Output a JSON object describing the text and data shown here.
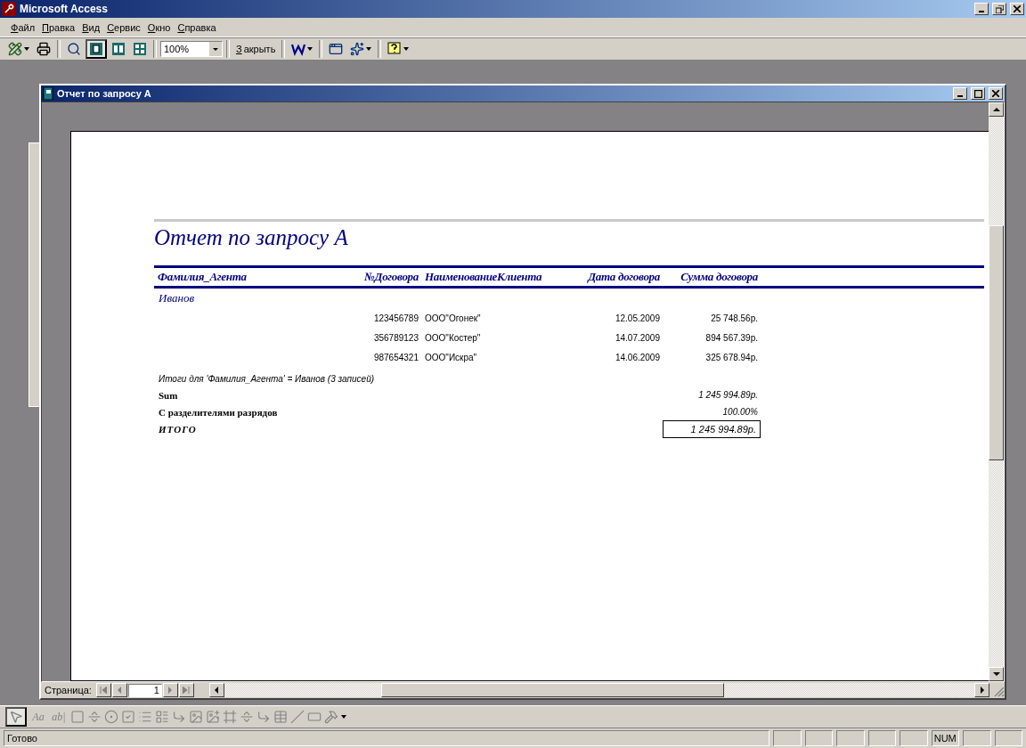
{
  "app_title": "Microsoft Access",
  "menu": [
    {
      "label": "Файл"
    },
    {
      "label": "Правка"
    },
    {
      "label": "Вид"
    },
    {
      "label": "Сервис"
    },
    {
      "label": "Окно"
    },
    {
      "label": "Справка"
    }
  ],
  "toolbar": {
    "zoom": "100%",
    "close_label": "Закрыть"
  },
  "report_window": {
    "title": "Отчет по запросу А"
  },
  "report": {
    "title": "Отчет по запросу А",
    "columns": [
      "Фамилия_Агента",
      "№Договора",
      "НаименованиеКлиента",
      "Дата договора",
      "Сумма договора"
    ],
    "group": "Иванов",
    "rows": [
      {
        "number": "123456789",
        "client": "ООО\"Огонек\"",
        "date": "12.05.2009",
        "amount": "25 748.56р."
      },
      {
        "number": "356789123",
        "client": "ООО\"Костер\"",
        "date": "14.07.2009",
        "amount": "894 567.39р."
      },
      {
        "number": "987654321",
        "client": "ООО\"Искра\"",
        "date": "14.06.2009",
        "amount": "325 678.94р."
      }
    ],
    "group_summary": "Итоги для 'Фамилия_Агента' =  Иванов (3 записей)",
    "totals": [
      {
        "kind": "plain",
        "label": "Sum",
        "value": "1 245 994.89р."
      },
      {
        "kind": "plain",
        "label": "С разделителями разрядов",
        "value": "100.00%"
      },
      {
        "kind": "boxed",
        "label": "ИТОГО",
        "value": "1 245 994.89р."
      }
    ]
  },
  "navigator": {
    "label": "Страница:",
    "page": "1"
  },
  "toolbox": {
    "glyphs": [
      "Aa",
      "ab|"
    ]
  },
  "status_bar": {
    "text": "Готово",
    "panels": [
      {
        "kind": "empty"
      },
      {
        "kind": "empty"
      },
      {
        "kind": "empty"
      },
      {
        "kind": "empty"
      },
      {
        "kind": "empty"
      },
      {
        "kind": "text",
        "label": "NUM"
      },
      {
        "kind": "empty"
      },
      {
        "kind": "empty"
      }
    ]
  }
}
